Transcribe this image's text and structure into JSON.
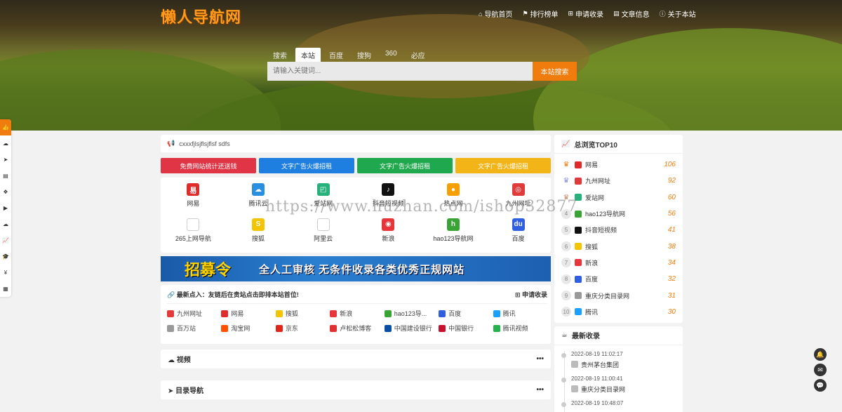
{
  "header": {
    "logo": "懒人导航网",
    "nav": [
      {
        "icon": "home-icon",
        "glyph": "⌂",
        "label": "导航首页"
      },
      {
        "icon": "flag-icon",
        "glyph": "⚑",
        "label": "排行榜单"
      },
      {
        "icon": "plus-square-icon",
        "glyph": "⊞",
        "label": "申请收录"
      },
      {
        "icon": "book-icon",
        "glyph": "▤",
        "label": "文章信息"
      },
      {
        "icon": "info-icon",
        "glyph": "ⓘ",
        "label": "关于本站"
      }
    ]
  },
  "search": {
    "tabs": [
      "搜索",
      "本站",
      "百度",
      "搜狗",
      "360",
      "必应"
    ],
    "active_tab": "本站",
    "placeholder": "请输入关键词...",
    "button": "本站搜索"
  },
  "notice": {
    "icon": "megaphone-icon",
    "text": "cxxxfjlsjflsjflsf sdfs"
  },
  "ads": [
    {
      "label": "免费网站统计还送钱",
      "color": "#e03545"
    },
    {
      "label": "文字广告火爆招租",
      "color": "#1e7fe0"
    },
    {
      "label": "文字广告火爆招租",
      "color": "#1fa84d"
    },
    {
      "label": "文字广告火爆招租",
      "color": "#f2b417"
    }
  ],
  "sites": [
    {
      "name": "网易",
      "color": "#e02b2b",
      "glyph": "易"
    },
    {
      "name": "腾讯云",
      "color": "#2b8fe0",
      "glyph": "☁"
    },
    {
      "name": "爱站网",
      "color": "#26b07a",
      "glyph": "◰"
    },
    {
      "name": "抖音短视频",
      "color": "#111111",
      "glyph": "♪"
    },
    {
      "name": "热点网",
      "color": "#f5a000",
      "glyph": "●"
    },
    {
      "name": "九州网址",
      "color": "#e03a3a",
      "glyph": "◎"
    },
    {
      "name": "265上网导航",
      "color": "#cccccc",
      "glyph": ""
    },
    {
      "name": "搜狐",
      "color": "#f5c400",
      "glyph": "S"
    },
    {
      "name": "阿里云",
      "color": "#ffffff",
      "glyph": ""
    },
    {
      "name": "新浪",
      "color": "#e8343b",
      "glyph": "◉"
    },
    {
      "name": "hao123导航网",
      "color": "#3aa335",
      "glyph": "h"
    },
    {
      "name": "百度",
      "color": "#2f5fe0",
      "glyph": "du"
    }
  ],
  "banner": {
    "title": "招募令",
    "slogan": "全人工审核 无条件收录各类优秀正规网站"
  },
  "latest": {
    "title": "最新点入：友链后在贵站点击即排本站首位!",
    "apply": "申请收录",
    "items": [
      {
        "name": "九州网址",
        "color": "#e03a3a"
      },
      {
        "name": "网易",
        "color": "#e02b2b"
      },
      {
        "name": "搜狐",
        "color": "#f5c400"
      },
      {
        "name": "新浪",
        "color": "#e8343b"
      },
      {
        "name": "hao123导...",
        "color": "#3aa335"
      },
      {
        "name": "百度",
        "color": "#2f5fe0"
      },
      {
        "name": "腾讯",
        "color": "#1aa0ff"
      },
      {
        "name": "百万站",
        "color": "#999999"
      },
      {
        "name": "淘宝网",
        "color": "#ff5000"
      },
      {
        "name": "京东",
        "color": "#e1251b"
      },
      {
        "name": "卢松松博客",
        "color": "#e03030"
      },
      {
        "name": "中国建设银行",
        "color": "#0a4ea2"
      },
      {
        "name": "中国银行",
        "color": "#c8102e"
      },
      {
        "name": "腾讯视频",
        "color": "#23b24b"
      }
    ]
  },
  "sections": [
    {
      "icon": "cloud-icon",
      "glyph": "☁",
      "title": "视频",
      "more": "•••"
    },
    {
      "icon": "paper-plane-icon",
      "glyph": "➤",
      "title": "目录导航",
      "more": "•••"
    }
  ],
  "top10": {
    "title": "总浏览TOP10",
    "rows": [
      {
        "rank": "1",
        "name": "网易",
        "count": "106",
        "color": "#e02b2b"
      },
      {
        "rank": "2",
        "name": "九州网址",
        "count": "92",
        "color": "#e03a3a"
      },
      {
        "rank": "3",
        "name": "爱站网",
        "count": "60",
        "color": "#26b07a"
      },
      {
        "rank": "4",
        "name": "hao123导航网",
        "count": "56",
        "color": "#3aa335"
      },
      {
        "rank": "5",
        "name": "抖音短视频",
        "count": "41",
        "color": "#111111"
      },
      {
        "rank": "6",
        "name": "搜狐",
        "count": "38",
        "color": "#f5c400"
      },
      {
        "rank": "7",
        "name": "新浪",
        "count": "34",
        "color": "#e8343b"
      },
      {
        "rank": "8",
        "name": "百度",
        "count": "32",
        "color": "#2f5fe0"
      },
      {
        "rank": "9",
        "name": "重庆分类目录网",
        "count": "31",
        "color": "#999999"
      },
      {
        "rank": "10",
        "name": "腾讯",
        "count": "30",
        "color": "#1aa0ff"
      }
    ]
  },
  "newest": {
    "title": "最新收录",
    "items": [
      {
        "time": "2022-08-19 11:02:17",
        "name": "贵州茅台集团"
      },
      {
        "time": "2022-08-19 11:00:41",
        "name": "重庆分类目录网"
      },
      {
        "time": "2022-08-19 10:48:07",
        "name": ""
      }
    ]
  },
  "watermark": "https://www.huzhan.com/ishop32877"
}
